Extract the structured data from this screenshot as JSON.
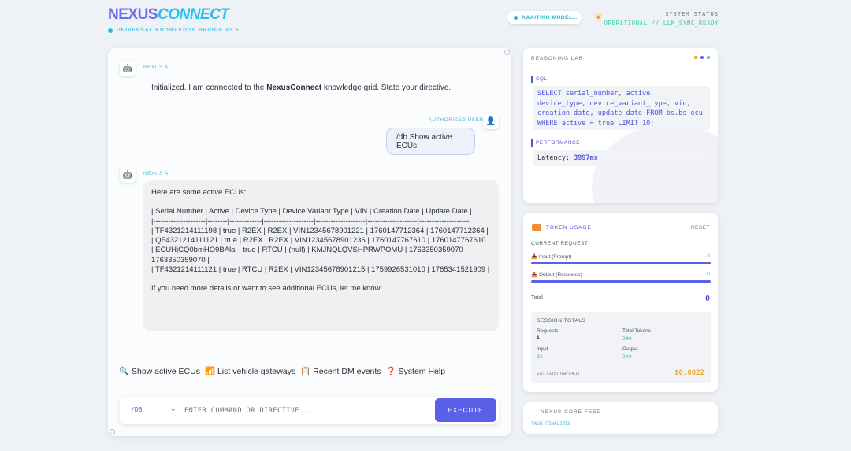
{
  "header": {
    "brand_part1": "NEXUS",
    "brand_part2": "CONNECT",
    "subtitle": "UNIVERSAL KNOWLEDGE BRIDGE V3.5",
    "awaiting_label": "AWAITING MODEL...",
    "status_label": "SYSTEM STATUS",
    "status_value": "OPERATIONAL // LLM_SYNC_READY"
  },
  "chat": {
    "ai_sender": "NEXUS AI",
    "user_sender": "AUTHORIZED USER",
    "greeting_prefix": "Initialized. I am connected to the ",
    "greeting_bold": "NexusConnect",
    "greeting_suffix": " knowledge grid. State your directive.",
    "user_message": "/db Show active ECUs",
    "reply_intro": "Here are some active ECUs:",
    "reply_table": "| Serial Number | Active | Device Type | Device Variant Type | VIN | Creation Date | Update Date |\n|---------------------|--------|-------------|--------------------|--------------------|--------------------|--------------------|\n| TF4321214111198 | true | R2EX | R2EX | VIN12345678901221 | 1760147712364 | 1760147712364 |\n| QF4321214111121 | true | R2EX | R2EX | VIN12345678901236 | 1760147767610 | 1760147767610 |\n| ECUHjCQ0bmHO9BAlal | true | RTCU | (null) | KMJNQLQVSHPRWPOMU | 1763350359070 | 1763350359070 |\n| TF4321214111121 | true | RTCU | R2EX | VIN12345678901215 | 1759926531010 | 1765341521909 |",
    "reply_outro": "If you need more details or want to see additional ECUs, let me know!"
  },
  "quick_actions": [
    {
      "icon": "🔍",
      "label": "Show active ECUs"
    },
    {
      "icon": "📶",
      "label": "List vehicle gateways"
    },
    {
      "icon": "📋",
      "label": "Recent DM events"
    },
    {
      "icon": "❓",
      "label": "System Help"
    }
  ],
  "command": {
    "prefix": "/DB",
    "placeholder": "ENTER COMMAND OR DIRECTIVE...",
    "execute_label": "EXECUTE"
  },
  "reasoning": {
    "title": "REASONING LAB",
    "sql_label": "SQL",
    "sql_query": "SELECT serial_number, active, device_type, device_variant_type, vin, creation_date, update_date FROM bs.bs_ecu WHERE active = true LIMIT 10;",
    "perf_label": "PERFORMANCE",
    "latency_label": "Latency:",
    "latency_value": "3997ms",
    "dot_colors": [
      "#f2a32a",
      "#5b60e8",
      "#3ccf9e"
    ]
  },
  "tokens": {
    "title": "TOKEN USAGE",
    "reset_label": "RESET",
    "current_label": "CURRENT REQUEST",
    "input_label": "📥 Input (Prompt)",
    "input_value": "0",
    "output_label": "📤 Output (Response)",
    "output_value": "0",
    "input_fill": 1.0,
    "output_fill": 1.0,
    "total_label": "Total",
    "total_value": "0",
    "session_title": "SESSION TOTALS",
    "requests_label": "Requests",
    "requests_value": "1",
    "total_tokens_label": "Total Tokens",
    "total_tokens_value": "340",
    "s_input_label": "Input",
    "s_input_value": "91",
    "s_output_label": "Output",
    "s_output_value": "249",
    "cost_label": "EST. COST (GPT-4.1)",
    "cost_value": "$0.0022"
  },
  "core_feed": {
    "title": "NEXUS CORE FEED",
    "status": "TASK FINALIZED"
  }
}
